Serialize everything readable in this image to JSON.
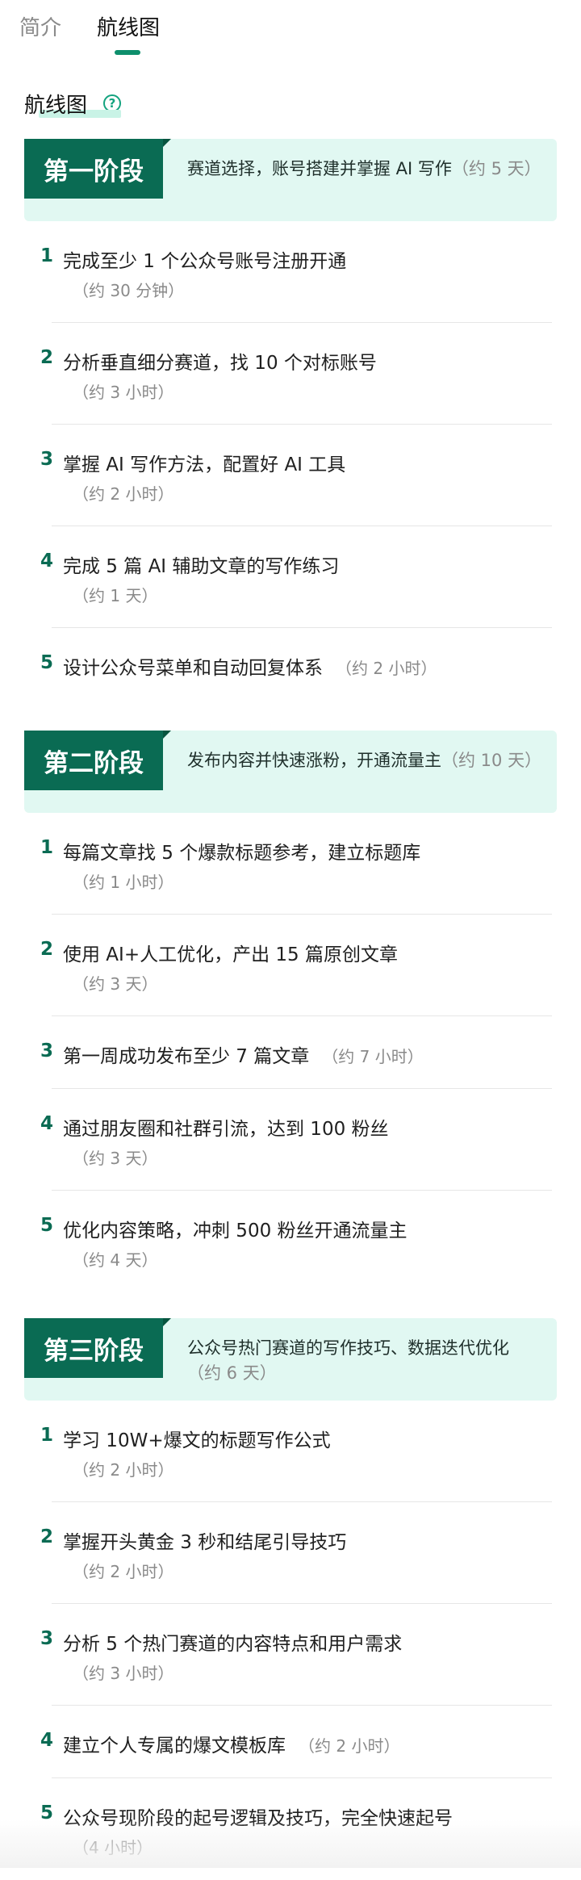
{
  "tabs": [
    {
      "label": "简介",
      "active": false
    },
    {
      "label": "航线图",
      "active": true
    }
  ],
  "section_title": "航线图",
  "colors": {
    "accent": "#0a6b53",
    "banner_bg": "#e1f8f2",
    "highlight": "#c9f3e6"
  },
  "stages": [
    {
      "badge": "第一阶段",
      "desc": "赛道选择，账号搭建并掌握 AI 写作",
      "est": "（约 5 天）",
      "tasks": [
        {
          "num": "1",
          "title": "完成至少 1 个公众号账号注册开通",
          "duration": "（约 30 分钟）",
          "inline": false
        },
        {
          "num": "2",
          "title": "分析垂直细分赛道，找 10 个对标账号",
          "duration": "（约 3 小时）",
          "inline": false
        },
        {
          "num": "3",
          "title": "掌握 AI 写作方法，配置好 AI 工具",
          "duration": "（约 2 小时）",
          "inline": false
        },
        {
          "num": "4",
          "title": "完成 5 篇 AI 辅助文章的写作练习",
          "duration": "（约 1 天）",
          "inline": false
        },
        {
          "num": "5",
          "title": "设计公众号菜单和自动回复体系",
          "duration": "（约 2 小时）",
          "inline": true
        }
      ]
    },
    {
      "badge": "第二阶段",
      "desc": "发布内容并快速涨粉，开通流量主",
      "est": "（约 10 天）",
      "tasks": [
        {
          "num": "1",
          "title": "每篇文章找 5 个爆款标题参考，建立标题库",
          "duration": "（约 1 小时）",
          "inline": false
        },
        {
          "num": "2",
          "title": "使用 AI+人工优化，产出 15 篇原创文章",
          "duration": "（约 3 天）",
          "inline": false
        },
        {
          "num": "3",
          "title": "第一周成功发布至少 7 篇文章",
          "duration": "（约 7 小时）",
          "inline": true
        },
        {
          "num": "4",
          "title": "通过朋友圈和社群引流，达到 100 粉丝",
          "duration": "（约 3 天）",
          "inline": false
        },
        {
          "num": "5",
          "title": "优化内容策略，冲刺 500 粉丝开通流量主",
          "duration": "（约 4 天）",
          "inline": false
        }
      ]
    },
    {
      "badge": "第三阶段",
      "desc": "公众号热门赛道的写作技巧、数据迭代优化",
      "est": "（约 6 天）",
      "tasks": [
        {
          "num": "1",
          "title": "学习 10W+爆文的标题写作公式",
          "duration": "（约 2 小时）",
          "inline": false
        },
        {
          "num": "2",
          "title": "掌握开头黄金 3 秒和结尾引导技巧",
          "duration": "（约 2 小时）",
          "inline": false
        },
        {
          "num": "3",
          "title": "分析 5 个热门赛道的内容特点和用户需求",
          "duration": "（约 3 小时）",
          "inline": false
        },
        {
          "num": "4",
          "title": "建立个人专属的爆文模板库",
          "duration": "（约 2 小时）",
          "inline": true
        },
        {
          "num": "5",
          "title": "公众号现阶段的起号逻辑及技巧，完全快速起号",
          "duration": "（4 小时）",
          "inline": false
        }
      ]
    }
  ]
}
